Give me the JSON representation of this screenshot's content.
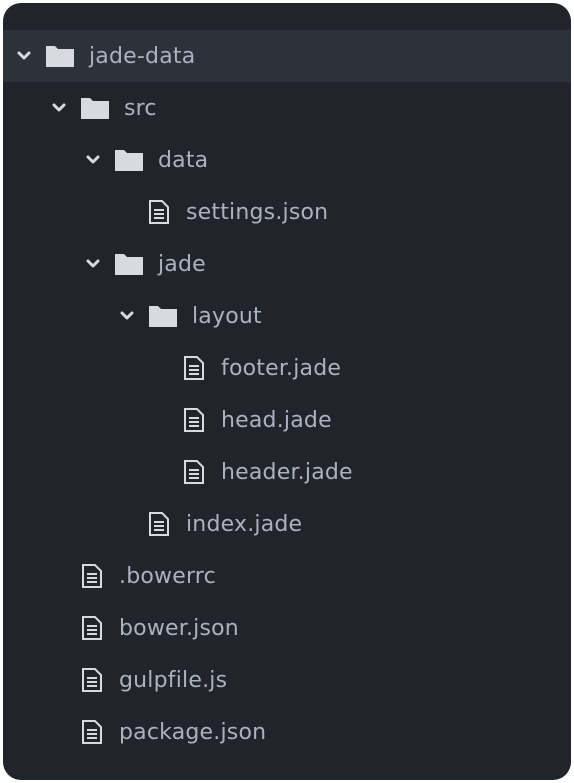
{
  "tree": {
    "root": {
      "label": "jade-data",
      "icon": "folder-icon",
      "expanded": true
    },
    "src": {
      "label": "src",
      "icon": "folder-icon",
      "expanded": true
    },
    "data_folder": {
      "label": "data",
      "icon": "folder-icon",
      "expanded": true
    },
    "settings_json": {
      "label": "settings.json",
      "icon": "file-icon"
    },
    "jade_folder": {
      "label": "jade",
      "icon": "folder-icon",
      "expanded": true
    },
    "layout_folder": {
      "label": "layout",
      "icon": "folder-icon",
      "expanded": true
    },
    "footer_jade": {
      "label": "footer.jade",
      "icon": "file-icon"
    },
    "head_jade": {
      "label": "head.jade",
      "icon": "file-icon"
    },
    "header_jade": {
      "label": "header.jade",
      "icon": "file-icon"
    },
    "index_jade": {
      "label": "index.jade",
      "icon": "file-icon"
    },
    "bowerrc": {
      "label": ".bowerrc",
      "icon": "file-icon"
    },
    "bower_json": {
      "label": "bower.json",
      "icon": "file-icon"
    },
    "gulpfile_js": {
      "label": "gulpfile.js",
      "icon": "file-icon"
    },
    "package_json": {
      "label": "package.json",
      "icon": "file-icon"
    }
  },
  "colors": {
    "panel_background": "#21252b",
    "selected_row": "#2c313a",
    "text": "#abb2bf",
    "icon": "#d7dae0"
  }
}
